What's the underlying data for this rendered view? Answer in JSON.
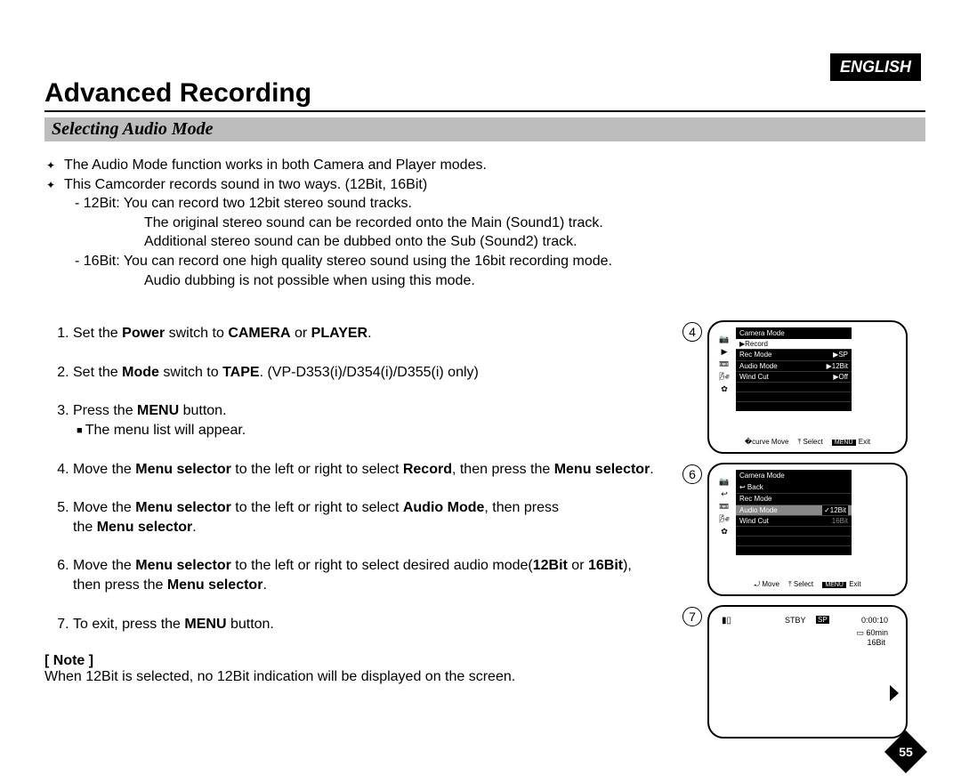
{
  "lang": "ENGLISH",
  "title": "Advanced Recording",
  "subtitle": "Selecting Audio Mode",
  "bullets": {
    "b1": "The Audio Mode function works in both Camera and Player modes.",
    "b2": "This Camcorder records sound in two ways. (12Bit, 16Bit)",
    "b2_s1_label": "- 12Bit:",
    "b2_s1_text": "You can record two 12bit stereo sound tracks.",
    "b2_s1_l2": "The original stereo sound can be recorded onto the Main (Sound1) track.",
    "b2_s1_l3": "Additional stereo sound can be dubbed onto the Sub (Sound2) track.",
    "b2_s2_label": "- 16Bit:",
    "b2_s2_text": "You can record one high quality stereo sound using the 16bit recording mode.",
    "b2_s2_l2": "Audio dubbing is not possible when using this mode."
  },
  "steps": {
    "s1a": "Set the ",
    "s1b": "Power",
    "s1c": " switch to ",
    "s1d": "CAMERA",
    "s1e": " or ",
    "s1f": "PLAYER",
    "s1g": ".",
    "s2a": "Set the ",
    "s2b": "Mode",
    "s2c": " switch to ",
    "s2d": "TAPE",
    "s2e": ". (VP-D353(i)/D354(i)/D355(i) only)",
    "s3a": "Press the ",
    "s3b": "MENU",
    "s3c": " button.",
    "s3sub": "The menu list will appear.",
    "s4a": "Move the ",
    "s4b": "Menu selector",
    "s4c": " to the left or right to select ",
    "s4d": "Record",
    "s4e": ", then press the ",
    "s4f": "Menu selector",
    "s4g": ".",
    "s5a": "Move the ",
    "s5b": "Menu selector",
    "s5c": " to the left or right to select ",
    "s5d": "Audio Mode",
    "s5e": ", then press",
    "s5f": "the ",
    "s5g": "Menu selector",
    "s5h": ".",
    "s6a": "Move the ",
    "s6b": "Menu selector",
    "s6c": " to the left or right to select desired audio mode(",
    "s6d": "12Bit",
    "s6e": " or ",
    "s6f": "16Bit",
    "s6g": "),",
    "s6h": "then press the ",
    "s6i": "Menu selector",
    "s6j": ".",
    "s7a": "To exit, press the ",
    "s7b": "MENU",
    "s7c": " button."
  },
  "note": {
    "head": "[ Note ]",
    "body": "When 12Bit is selected, no 12Bit indication will be displayed on the screen."
  },
  "screens": {
    "s4": {
      "num": "4",
      "title": "Camera Mode",
      "sub": "▶Record",
      "rows": [
        {
          "l": "Rec Mode",
          "r": "▶SP"
        },
        {
          "l": "Audio Mode",
          "r": "▶12Bit"
        },
        {
          "l": "Wind Cut",
          "r": "▶Off"
        }
      ],
      "bottom": {
        "move": "Move",
        "select": "Select",
        "exit": "Exit",
        "menu": "MENU"
      }
    },
    "s6": {
      "num": "6",
      "title": "Camera Mode",
      "sub": "↩ Back",
      "rows": [
        {
          "l": "Rec Mode",
          "r": ""
        },
        {
          "l": "Audio Mode",
          "r": "✓12Bit",
          "sel": true
        },
        {
          "l": "Wind Cut",
          "r": "16Bit"
        }
      ],
      "bottom": {
        "move": "Move",
        "select": "Select",
        "exit": "Exit",
        "menu": "MENU"
      }
    },
    "s7": {
      "num": "7",
      "stby": "STBY",
      "sp": "SP",
      "time": "0:00:10",
      "remain": "60min",
      "bits": "16Bit"
    }
  },
  "pagenum": "55"
}
